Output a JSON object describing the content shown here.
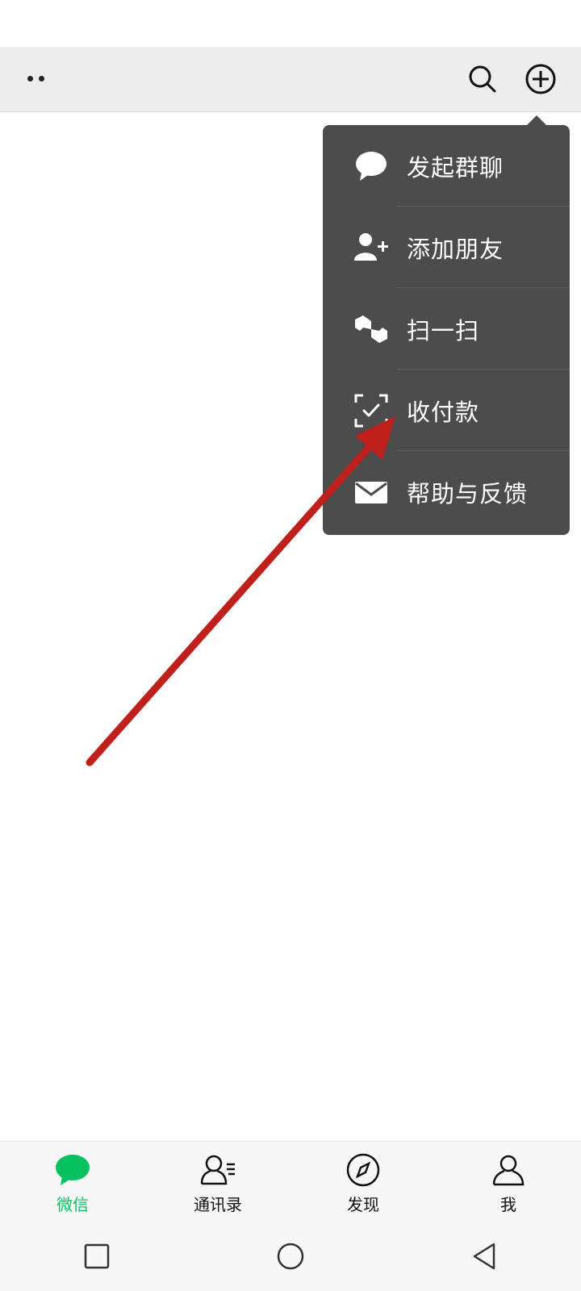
{
  "menu": {
    "items": [
      {
        "label": "发起群聊",
        "icon": "chat-bubble-icon"
      },
      {
        "label": "添加朋友",
        "icon": "add-friend-icon"
      },
      {
        "label": "扫一扫",
        "icon": "scan-icon"
      },
      {
        "label": "收付款",
        "icon": "payment-icon"
      },
      {
        "label": "帮助与反馈",
        "icon": "mail-icon"
      }
    ]
  },
  "tabbar": {
    "tabs": [
      {
        "label": "微信",
        "icon": "chat-icon",
        "active": true
      },
      {
        "label": "通讯录",
        "icon": "contacts-icon",
        "active": false
      },
      {
        "label": "发现",
        "icon": "compass-icon",
        "active": false
      },
      {
        "label": "我",
        "icon": "person-icon",
        "active": false
      }
    ]
  },
  "colors": {
    "accent_green": "#07c160",
    "menu_bg": "#4c4c4c",
    "arrow_red": "#c0201c"
  }
}
